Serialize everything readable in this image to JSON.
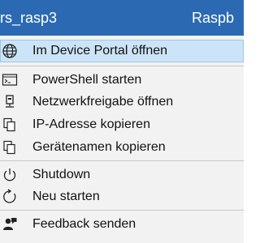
{
  "titlebar": {
    "left_text": "rs_rasp3",
    "right_text": "Raspb"
  },
  "menu": {
    "items": [
      {
        "label": "Im Device Portal öffnen",
        "icon": "globe-icon"
      },
      {
        "label": "PowerShell starten",
        "icon": "powershell-icon"
      },
      {
        "label": "Netzwerkfreigabe öffnen",
        "icon": "network-share-icon"
      },
      {
        "label": "IP-Adresse kopieren",
        "icon": "copy-icon"
      },
      {
        "label": "Gerätenamen kopieren",
        "icon": "copy-icon"
      },
      {
        "label": "Shutdown",
        "icon": "power-icon"
      },
      {
        "label": "Neu starten",
        "icon": "restart-icon"
      },
      {
        "label": "Feedback senden",
        "icon": "feedback-icon"
      }
    ]
  },
  "colors": {
    "titlebar": "#2b6ab3",
    "highlight": "#cce4f7"
  }
}
